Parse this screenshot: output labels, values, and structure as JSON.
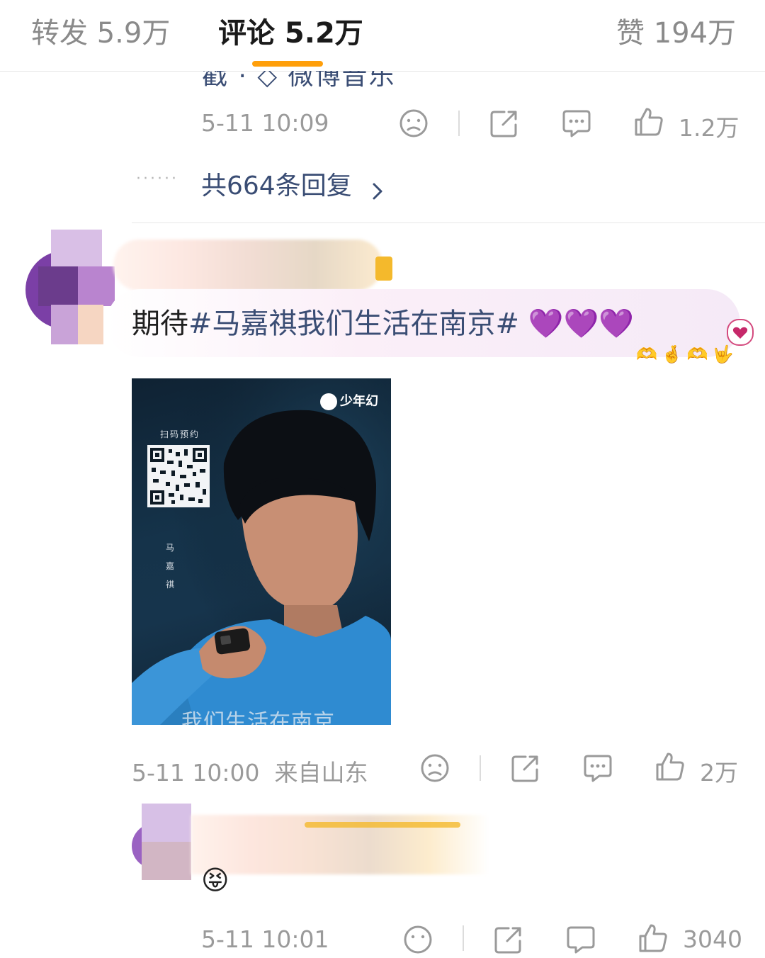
{
  "tabs": [
    {
      "label": "转发 5.9万"
    },
    {
      "label": "评论 5.2万"
    },
    {
      "label": "赞 194万"
    }
  ],
  "comment1": {
    "cut_text": "戳 · ◇ 微博音乐",
    "timestamp": "5-11 10:09",
    "likes": "1.2万",
    "replies_link": "共664条回复"
  },
  "comment2": {
    "text_prefix": "期待",
    "topic": "#马嘉祺我们生活在南京#",
    "hearts": "💜💜💜",
    "image": {
      "brand": "少年幻",
      "qr_label": "扫码预约",
      "name": "马嘉祺",
      "movie_title": "我们生活在南京"
    },
    "timestamp": "5-11 10:00",
    "location": "来自山东",
    "likes": "2万"
  },
  "comment3": {
    "timestamp": "5-11 10:01",
    "likes": "3040"
  },
  "colors": {
    "accent": "#ff9f0a",
    "link": "#3a4d74",
    "heart": "#9b2bd8"
  },
  "icons": [
    "sad-face-icon",
    "share-icon",
    "comment-icon",
    "thumbs-up-icon",
    "chevron-right-icon",
    "purple-heart-icon"
  ]
}
